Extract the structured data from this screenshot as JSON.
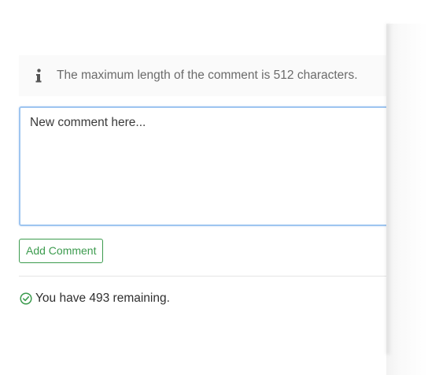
{
  "info": {
    "icon": "info-icon",
    "text": "The maximum length of the comment is 512 characters."
  },
  "comment": {
    "placeholder": "New comment here...",
    "value": ""
  },
  "add_button": {
    "label": "Add Comment"
  },
  "status": {
    "icon": "check-circle-icon",
    "text": "You have 493 remaining."
  },
  "colors": {
    "accent_green": "#3c9b4e",
    "focus_border": "#9ec5f0",
    "info_text": "#6b6b6b"
  }
}
